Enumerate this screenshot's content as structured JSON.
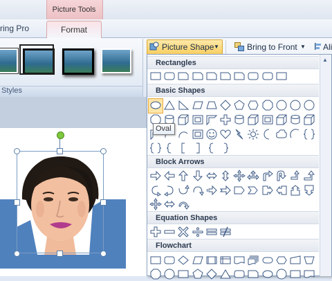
{
  "ribbon": {
    "context_group": "Picture Tools",
    "tabs": [
      {
        "label": "ring Pro"
      },
      {
        "label": "Format"
      }
    ],
    "styles_group_label": "Styles",
    "picture_shape_label": "Picture Shape",
    "bring_to_front_label": "Bring to Front",
    "align_label": "Ali"
  },
  "shape_menu": {
    "sections": [
      {
        "title": "Rectangles"
      },
      {
        "title": "Basic Shapes"
      },
      {
        "title": "Block Arrows"
      },
      {
        "title": "Equation Shapes"
      },
      {
        "title": "Flowchart"
      }
    ],
    "tooltip": "Oval"
  },
  "colors": {
    "accent_highlight": "#fde6a8",
    "format_tab": "#f6d5d8",
    "shape_blue": "#4f81bd"
  }
}
